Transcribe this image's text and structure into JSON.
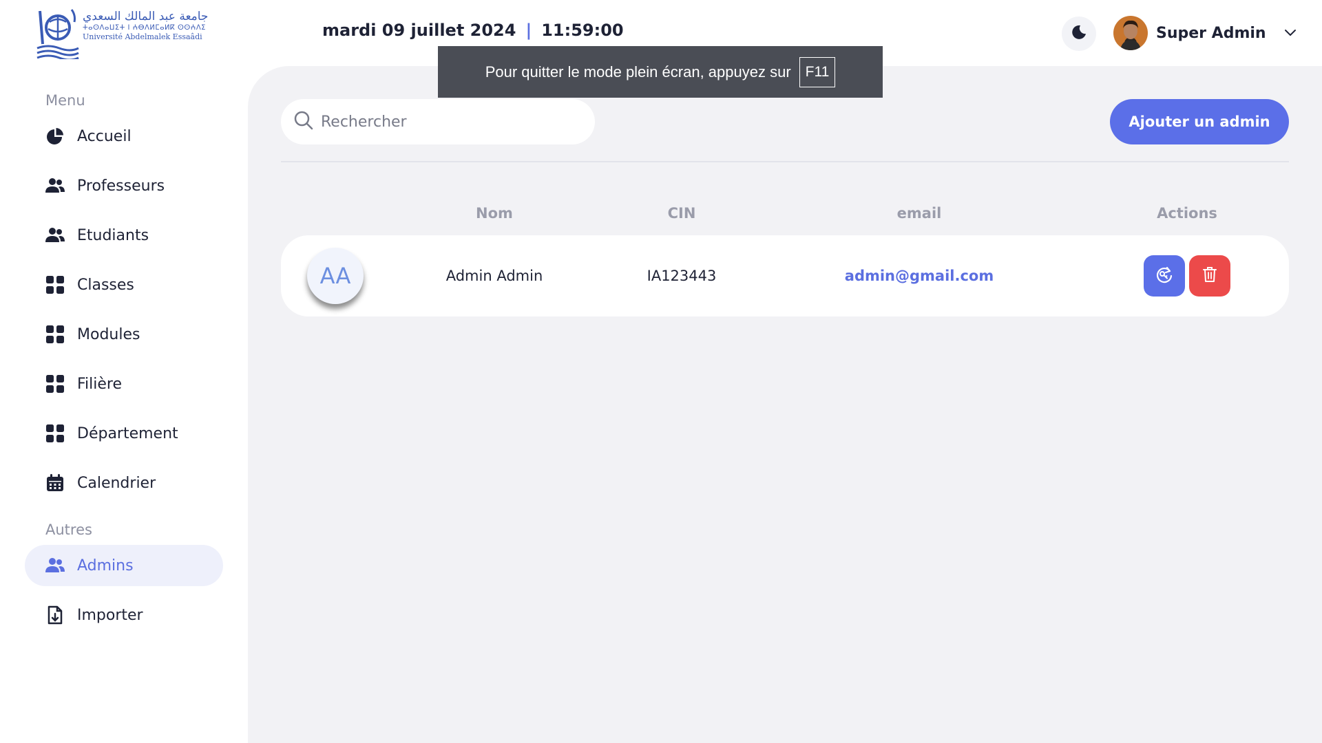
{
  "brand": {
    "arabic_name": "جامعة عبد المالك السعدي",
    "tifinagh_name": "ⵜⴰⵙⴷⴰⵡⵉⵜ ⵏ ⵄⴱⴷⵍⵎⴰⵍⴽ ⵙⵙⵄⴷⵉ",
    "french_name": "Université Abdelmalek Essaâdi"
  },
  "sidebar": {
    "menu_title": "Menu",
    "menu_items": [
      {
        "label": "Accueil",
        "icon": "pie-chart-icon"
      },
      {
        "label": "Professeurs",
        "icon": "users-icon"
      },
      {
        "label": "Etudiants",
        "icon": "users-icon"
      },
      {
        "label": "Classes",
        "icon": "grid-icon"
      },
      {
        "label": "Modules",
        "icon": "grid-icon"
      },
      {
        "label": "Filière",
        "icon": "grid-icon"
      },
      {
        "label": "Département",
        "icon": "grid-icon"
      },
      {
        "label": "Calendrier",
        "icon": "calendar-icon"
      }
    ],
    "other_title": "Autres",
    "other_items": [
      {
        "label": "Admins",
        "icon": "users-icon",
        "active": true
      },
      {
        "label": "Importer",
        "icon": "file-import-icon"
      }
    ]
  },
  "header": {
    "date": "mardi 09 juillet 2024",
    "separator": "|",
    "time": "11:59:00",
    "theme_icon": "moon-icon",
    "user_name": "Super Admin"
  },
  "toast": {
    "message": "Pour quitter le mode plein écran, appuyez sur",
    "key": "F11"
  },
  "toolbar": {
    "search_placeholder": "Rechercher",
    "add_button": "Ajouter un admin"
  },
  "table": {
    "columns": [
      "Nom",
      "CIN",
      "email",
      "Actions"
    ],
    "rows": [
      {
        "initials": "AA",
        "name": "Admin Admin",
        "cin": "IA123443",
        "email": "admin@gmail.com"
      }
    ]
  },
  "colors": {
    "accent": "#5b6fe8",
    "danger": "#ec4a4a",
    "panel_bg": "#f2f2f5"
  }
}
